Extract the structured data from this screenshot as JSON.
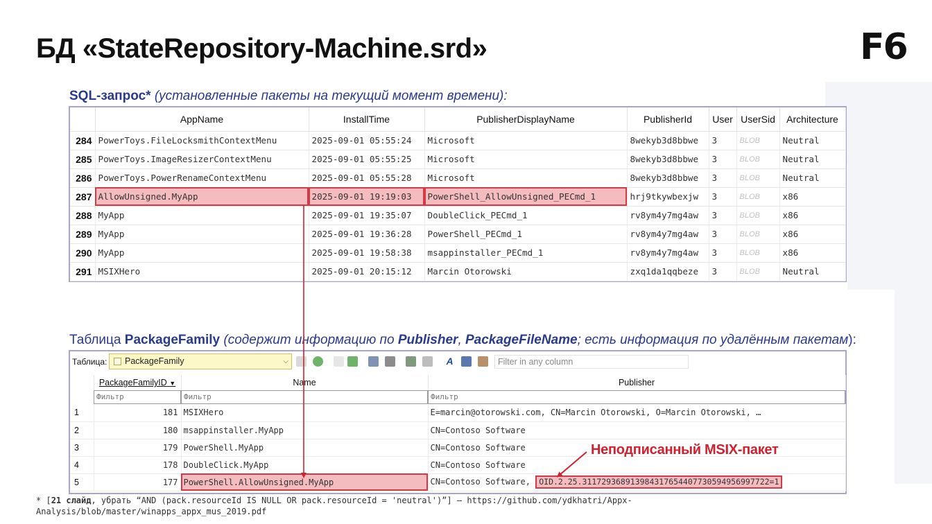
{
  "slide": {
    "title": "БД «StateRepository-Machine.srd»",
    "logo": "F6"
  },
  "sql_section": {
    "heading_prefix": "SQL-запрос*",
    "heading_note": " (установленные пакеты на текущий момент времени):"
  },
  "sql_result": {
    "columns": [
      "AppName",
      "InstallTime",
      "PublisherDisplayName",
      "PublisherId",
      "User",
      "UserSid",
      "Architecture"
    ],
    "rows": [
      {
        "num": "284",
        "app": "PowerToys.FileLocksmithContextMenu",
        "time": "2025-09-01 05:55:24",
        "publisher": "Microsoft",
        "pid": "8wekyb3d8bbwe",
        "user": "3",
        "sid": "BLOB",
        "arch": "Neutral"
      },
      {
        "num": "285",
        "app": "PowerToys.ImageResizerContextMenu",
        "time": "2025-09-01 05:55:25",
        "publisher": "Microsoft",
        "pid": "8wekyb3d8bbwe",
        "user": "3",
        "sid": "BLOB",
        "arch": "Neutral"
      },
      {
        "num": "286",
        "app": "PowerToys.PowerRenameContextMenu",
        "time": "2025-09-01 05:55:28",
        "publisher": "Microsoft",
        "pid": "8wekyb3d8bbwe",
        "user": "3",
        "sid": "BLOB",
        "arch": "Neutral"
      },
      {
        "num": "287",
        "app": "AllowUnsigned.MyApp",
        "time": "2025-09-01 19:19:03",
        "publisher": "PowerShell_AllowUnsigned_PECmd_1",
        "pid": "hrj9tkywbexjw",
        "user": "3",
        "sid": "BLOB",
        "arch": "x86"
      },
      {
        "num": "288",
        "app": "MyApp",
        "time": "2025-09-01 19:35:07",
        "publisher": "DoubleClick_PECmd_1",
        "pid": "rv8ym4y7mg4aw",
        "user": "3",
        "sid": "BLOB",
        "arch": "x86"
      },
      {
        "num": "289",
        "app": "MyApp",
        "time": "2025-09-01 19:36:28",
        "publisher": "PowerShell_PECmd_1",
        "pid": "rv8ym4y7mg4aw",
        "user": "3",
        "sid": "BLOB",
        "arch": "x86"
      },
      {
        "num": "290",
        "app": "MyApp",
        "time": "2025-09-01 19:58:38",
        "publisher": "msappinstaller_PECmd_1",
        "pid": "rv8ym4y7mg4aw",
        "user": "3",
        "sid": "BLOB",
        "arch": "x86"
      },
      {
        "num": "291",
        "app": "MSIXHero",
        "time": "2025-09-01 20:15:12",
        "publisher": "Marcin Otorowski",
        "pid": "zxq1da1qqbeze",
        "user": "3",
        "sid": "BLOB",
        "arch": "Neutral"
      }
    ]
  },
  "pf_section": {
    "heading_a": "Таблица ",
    "heading_b": "PackageFamily",
    "heading_c": " (содержит информацию по ",
    "heading_d": "Publisher",
    "heading_e": ", ",
    "heading_f": "PackageFileName",
    "heading_g": "; есть информация по удалённым пакетам",
    "heading_h": "):"
  },
  "pf_panel": {
    "table_label": "Таблица:",
    "table_selected": "PackageFamily",
    "filter_all_placeholder": "Filter in any column",
    "columns": {
      "id": "PackageFamilyID",
      "name": "Name",
      "publisher": "Publisher"
    },
    "filter_placeholder": "Фильтр",
    "rows": [
      {
        "n": "1",
        "id": "181",
        "name": "MSIXHero",
        "publisher": "E=marcin@otorowski.com, CN=Marcin Otorowski, O=Marcin Otorowski, …",
        "oid": ""
      },
      {
        "n": "2",
        "id": "180",
        "name": "msappinstaller.MyApp",
        "publisher": "CN=Contoso Software",
        "oid": ""
      },
      {
        "n": "3",
        "id": "179",
        "name": "PowerShell.MyApp",
        "publisher": "CN=Contoso Software",
        "oid": ""
      },
      {
        "n": "4",
        "id": "178",
        "name": "DoubleClick.MyApp",
        "publisher": "CN=Contoso Software",
        "oid": ""
      },
      {
        "n": "5",
        "id": "177",
        "name": "PowerShell.AllowUnsigned.MyApp",
        "publisher": "CN=Contoso Software, ",
        "oid": "OID.2.25.311729368913984317654407730594956997722=1"
      }
    ]
  },
  "annotation": "Неподписанный MSIX-пакет",
  "footnote": {
    "line1_a": "* [",
    "line1_b": "21 слайд",
    "line1_c": ", убрать “AND (pack.resourceId IS NULL OR pack.resourceId = 'neutral')”] — https://github.com/ydkhatri/Appx-",
    "line2": "Analysis/blob/master/winapps_appx_mus_2019.pdf"
  },
  "colors": {
    "heading": "#2a3a8c",
    "highlight_fill": "#f5bcc0",
    "highlight_border": "#d23a45",
    "annotation": "#d2202e",
    "panel_border": "#a8a4d6"
  }
}
